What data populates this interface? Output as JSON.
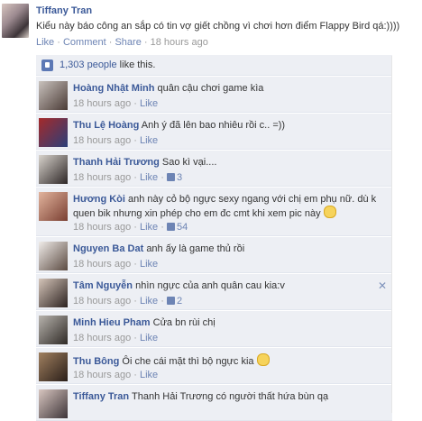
{
  "post": {
    "author": "Tiffany Tran",
    "text": "Kiểu này báo công an sắp có tin vợ giết chồng vì chơi hơn điểm Flappy Bird qá:))))",
    "actions": {
      "like": "Like",
      "comment": "Comment",
      "share": "Share",
      "separator": "·",
      "time": "18 hours ago"
    }
  },
  "likes": {
    "count": "1,303 people",
    "suffix": " like this."
  },
  "comments": [
    {
      "name": "Hoàng Nhật Minh",
      "text": "quân cậu chơi game kìa",
      "time": "18 hours ago",
      "like": "Like",
      "likes": "",
      "avatar": [
        "#c9c2bd",
        "#4a3b36"
      ]
    },
    {
      "name": "Thu Lệ Hoàng",
      "text": "Anh ý đã lên bao nhiêu rồi c.. =))",
      "time": "18 hours ago",
      "like": "Like",
      "likes": "",
      "avatar": [
        "#a52a2a",
        "#2b3f7a"
      ]
    },
    {
      "name": "Thanh Hải Trương",
      "text": "Sao kì vại....",
      "time": "18 hours ago",
      "like": "Like",
      "likes": "3",
      "avatar": [
        "#d8d3cc",
        "#2d2626"
      ]
    },
    {
      "name": "Hương Kòi",
      "text": "anh này cỏ bộ ngực sexy ngang với chị em phụ nữ. dù k quen bik nhưng xin phép cho em đc cmt khi xem pic này",
      "time": "18 hours ago",
      "like": "Like",
      "likes": "54",
      "avatar": [
        "#e2b49d",
        "#7a3f32"
      ],
      "tall": true,
      "emoji": true
    },
    {
      "name": "Nguyen Ba Dat",
      "text": "anh ấy là game thủ rồi",
      "time": "18 hours ago",
      "like": "Like",
      "likes": "",
      "avatar": [
        "#f0ece9",
        "#5b4a41"
      ]
    },
    {
      "name": "Tâm Nguyễn",
      "text": "nhìn ngực của anh quân cau kia:v",
      "time": "18 hours ago",
      "like": "Like",
      "likes": "2",
      "avatar": [
        "#d5c5b9",
        "#2c2220"
      ],
      "close": "✕"
    },
    {
      "name": "Minh Hieu Pham",
      "text": "Cửa bn rùi chị",
      "time": "18 hours ago",
      "like": "Like",
      "likes": "",
      "avatar": [
        "#b7b3ad",
        "#2f2a26"
      ]
    },
    {
      "name": "Thu Bông",
      "text": "Ôi che cái mặt thì bộ ngực kia",
      "time": "18 hours ago",
      "like": "Like",
      "likes": "",
      "avatar": [
        "#a08060",
        "#2a1e18"
      ],
      "emoji": true
    },
    {
      "name": "Tiffany Tran",
      "text": "Thanh Hải Trương có người thất hứa bùn qạ",
      "time": "",
      "like": "",
      "likes": "",
      "avatar": [
        "#d8c6c0",
        "#3d3438"
      ]
    }
  ]
}
